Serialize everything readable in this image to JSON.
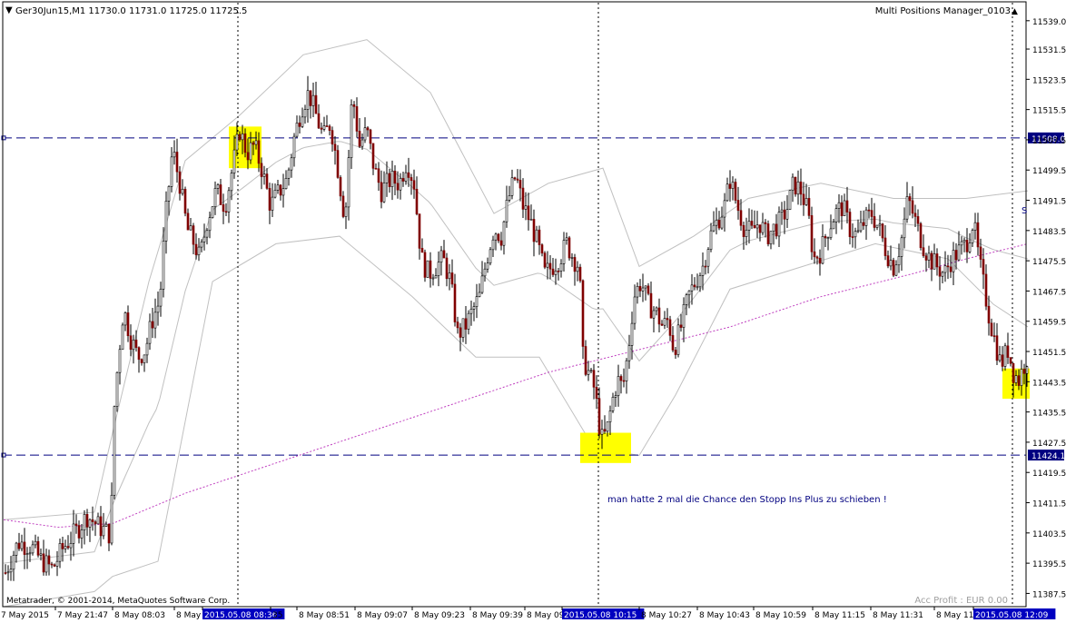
{
  "window": {
    "symbol_line": "Ger30Jun15,M1  11730.0 11731.0 11725.0 11725.5",
    "indicator_name": "Multi Positions Manager_0103",
    "copyright": "Metatrader, © 2001-2014, MetaQuotes Software Corp.",
    "acc_profit": "Acc Profit : EUR 0.00",
    "annotation": "man hatte 2 mal die Chance den Stopp Ins Plus zu schieben !",
    "edge_marker": "S"
  },
  "colors": {
    "background": "#ffffff",
    "candle_bull": "#ffffff",
    "candle_bear": "#800000",
    "wick": "#000000",
    "band": "#c0c0c0",
    "moving_average": "#c040c0",
    "hline": "#000080",
    "highlight": "#ffff00",
    "axis_label_bg": "#000080"
  },
  "chart_data": {
    "type": "candlestick",
    "title": "Ger30Jun15,M1",
    "ylim": [
      11384,
      11544
    ],
    "y_ticks": [
      "11539.0",
      "11531.5",
      "11523.5",
      "11515.5",
      "11507.5",
      "11499.5",
      "11491.5",
      "11483.5",
      "11475.5",
      "11467.5",
      "11459.5",
      "11451.5",
      "11443.5",
      "11435.5",
      "11427.5",
      "11419.5",
      "11411.5",
      "11403.5",
      "11395.5",
      "11387.5"
    ],
    "x_ticks": [
      "7 May 2015",
      "7 May 21:47",
      "8 May 08:03",
      "8 May",
      "2015.05.08 08:36",
      "35",
      "8 May 08:51",
      "8 May 09:07",
      "8 May 09:23",
      "8 May 09:39",
      "8 May 09:",
      "2015.05.08 10:15",
      "8 May 10:27",
      "8 May 10:43",
      "8 May 10:59",
      "8 May 11:15",
      "8 May 11:31",
      "8 May 11:4",
      "2015.05.08 12:09"
    ],
    "highlighted_x": [
      "2015.05.08 08:36",
      "2015.05.08 10:15",
      "2015.05.08 12:09"
    ],
    "horizontal_lines": [
      {
        "value": 11508.0,
        "label": "11508.0"
      },
      {
        "value": 11424.1,
        "label": "11424.1"
      }
    ],
    "vertical_lines_at": [
      "2015.05.08 08:36",
      "2015.05.08 10:15",
      "2015.05.08 12:09"
    ],
    "price_path": [
      [
        0,
        11393
      ],
      [
        14,
        11401
      ],
      [
        28,
        11400
      ],
      [
        40,
        11396
      ],
      [
        52,
        11394
      ],
      [
        62,
        11399
      ],
      [
        78,
        11404
      ],
      [
        90,
        11408
      ],
      [
        104,
        11405
      ],
      [
        116,
        11403
      ],
      [
        120,
        11437
      ],
      [
        124,
        11449
      ],
      [
        130,
        11463
      ],
      [
        138,
        11455
      ],
      [
        146,
        11450
      ],
      [
        154,
        11452
      ],
      [
        162,
        11460
      ],
      [
        170,
        11465
      ],
      [
        176,
        11486
      ],
      [
        184,
        11505
      ],
      [
        192,
        11496
      ],
      [
        200,
        11484
      ],
      [
        208,
        11480
      ],
      [
        214,
        11476
      ],
      [
        222,
        11486
      ],
      [
        232,
        11494
      ],
      [
        242,
        11490
      ],
      [
        250,
        11500
      ],
      [
        258,
        11510
      ],
      [
        266,
        11504
      ],
      [
        274,
        11506
      ],
      [
        282,
        11500
      ],
      [
        292,
        11490
      ],
      [
        302,
        11494
      ],
      [
        310,
        11497
      ],
      [
        318,
        11508
      ],
      [
        326,
        11516
      ],
      [
        334,
        11520
      ],
      [
        342,
        11514
      ],
      [
        350,
        11508
      ],
      [
        358,
        11512
      ],
      [
        366,
        11500
      ],
      [
        374,
        11486
      ],
      [
        382,
        11520
      ],
      [
        390,
        11506
      ],
      [
        398,
        11510
      ],
      [
        406,
        11500
      ],
      [
        414,
        11494
      ],
      [
        424,
        11497
      ],
      [
        434,
        11496
      ],
      [
        442,
        11502
      ],
      [
        450,
        11496
      ],
      [
        458,
        11476
      ],
      [
        466,
        11472
      ],
      [
        474,
        11474
      ],
      [
        482,
        11476
      ],
      [
        490,
        11470
      ],
      [
        498,
        11456
      ],
      [
        506,
        11458
      ],
      [
        514,
        11462
      ],
      [
        522,
        11466
      ],
      [
        530,
        11476
      ],
      [
        538,
        11484
      ],
      [
        546,
        11482
      ],
      [
        554,
        11492
      ],
      [
        562,
        11498
      ],
      [
        570,
        11490
      ],
      [
        578,
        11486
      ],
      [
        586,
        11480
      ],
      [
        594,
        11472
      ],
      [
        602,
        11474
      ],
      [
        610,
        11476
      ],
      [
        618,
        11480
      ],
      [
        626,
        11476
      ],
      [
        632,
        11474
      ],
      [
        636,
        11450
      ],
      [
        642,
        11446
      ],
      [
        648,
        11442
      ],
      [
        652,
        11436
      ],
      [
        656,
        11428
      ],
      [
        662,
        11430
      ],
      [
        668,
        11438
      ],
      [
        674,
        11444
      ],
      [
        680,
        11442
      ],
      [
        686,
        11452
      ],
      [
        692,
        11466
      ],
      [
        700,
        11470
      ],
      [
        708,
        11464
      ],
      [
        716,
        11462
      ],
      [
        724,
        11458
      ],
      [
        730,
        11460
      ],
      [
        736,
        11452
      ],
      [
        744,
        11458
      ],
      [
        752,
        11466
      ],
      [
        760,
        11470
      ],
      [
        768,
        11474
      ],
      [
        776,
        11482
      ],
      [
        784,
        11486
      ],
      [
        792,
        11490
      ],
      [
        798,
        11497
      ],
      [
        806,
        11490
      ],
      [
        814,
        11484
      ],
      [
        822,
        11483
      ],
      [
        830,
        11486
      ],
      [
        838,
        11482
      ],
      [
        846,
        11484
      ],
      [
        854,
        11486
      ],
      [
        862,
        11490
      ],
      [
        868,
        11496
      ],
      [
        876,
        11494
      ],
      [
        884,
        11488
      ],
      [
        890,
        11476
      ],
      [
        898,
        11478
      ],
      [
        906,
        11484
      ],
      [
        914,
        11488
      ],
      [
        922,
        11490
      ],
      [
        930,
        11484
      ],
      [
        938,
        11482
      ],
      [
        946,
        11486
      ],
      [
        954,
        11488
      ],
      [
        962,
        11484
      ],
      [
        970,
        11478
      ],
      [
        978,
        11474
      ],
      [
        986,
        11480
      ],
      [
        994,
        11492
      ],
      [
        1002,
        11486
      ],
      [
        1010,
        11480
      ],
      [
        1018,
        11476
      ],
      [
        1026,
        11474
      ],
      [
        1034,
        11472
      ],
      [
        1042,
        11476
      ],
      [
        1050,
        11478
      ],
      [
        1058,
        11480
      ],
      [
        1066,
        11486
      ],
      [
        1072,
        11476
      ],
      [
        1078,
        11468
      ],
      [
        1084,
        11460
      ],
      [
        1090,
        11454
      ],
      [
        1096,
        11448
      ],
      [
        1104,
        11452
      ],
      [
        1110,
        11446
      ],
      [
        1116,
        11444
      ],
      [
        1122,
        11448
      ],
      [
        1128,
        11452
      ]
    ],
    "moving_average_path": [
      [
        0,
        11407
      ],
      [
        60,
        11405
      ],
      [
        120,
        11406
      ],
      [
        200,
        11414
      ],
      [
        300,
        11422
      ],
      [
        400,
        11430
      ],
      [
        500,
        11438
      ],
      [
        600,
        11446
      ],
      [
        700,
        11452
      ],
      [
        800,
        11458
      ],
      [
        900,
        11466
      ],
      [
        1000,
        11472
      ],
      [
        1060,
        11476
      ],
      [
        1128,
        11480
      ]
    ],
    "band_upper_path": [
      [
        0,
        11407
      ],
      [
        100,
        11409
      ],
      [
        120,
        11430
      ],
      [
        160,
        11470
      ],
      [
        200,
        11502
      ],
      [
        260,
        11514
      ],
      [
        330,
        11530
      ],
      [
        400,
        11534
      ],
      [
        470,
        11520
      ],
      [
        540,
        11488
      ],
      [
        600,
        11496
      ],
      [
        660,
        11500
      ],
      [
        700,
        11474
      ],
      [
        760,
        11482
      ],
      [
        820,
        11492
      ],
      [
        900,
        11496
      ],
      [
        980,
        11492
      ],
      [
        1060,
        11492
      ],
      [
        1128,
        11494
      ]
    ],
    "band_lower_path": [
      [
        0,
        11384
      ],
      [
        100,
        11388
      ],
      [
        120,
        11392
      ],
      [
        170,
        11396
      ],
      [
        230,
        11470
      ],
      [
        300,
        11480
      ],
      [
        370,
        11482
      ],
      [
        450,
        11466
      ],
      [
        520,
        11450
      ],
      [
        590,
        11450
      ],
      [
        650,
        11426
      ],
      [
        700,
        11424
      ],
      [
        740,
        11440
      ],
      [
        800,
        11468
      ],
      [
        880,
        11474
      ],
      [
        960,
        11480
      ],
      [
        1040,
        11476
      ],
      [
        1090,
        11464
      ],
      [
        1128,
        11458
      ]
    ],
    "highlight_boxes": [
      {
        "x_from": 248,
        "x_to": 284,
        "y_from": 11511,
        "y_to": 11500
      },
      {
        "x_from": 635,
        "x_to": 691,
        "y_from": 11430,
        "y_to": 11422
      },
      {
        "x_from": 1100,
        "x_to": 1130,
        "y_from": 11447,
        "y_to": 11439
      }
    ]
  }
}
